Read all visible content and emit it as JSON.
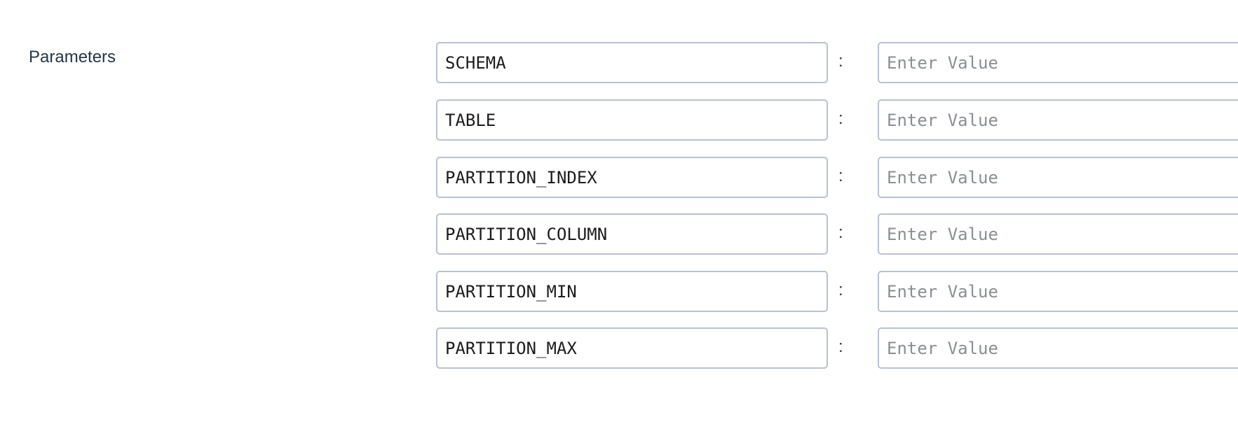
{
  "section": {
    "label": "Parameters"
  },
  "parameters": [
    {
      "key": "SCHEMA",
      "value": "",
      "placeholder": "Enter Value"
    },
    {
      "key": "TABLE",
      "value": "",
      "placeholder": "Enter Value"
    },
    {
      "key": "PARTITION_INDEX",
      "value": "",
      "placeholder": "Enter Value"
    },
    {
      "key": "PARTITION_COLUMN",
      "value": "",
      "placeholder": "Enter Value"
    },
    {
      "key": "PARTITION_MIN",
      "value": "",
      "placeholder": "Enter Value"
    },
    {
      "key": "PARTITION_MAX",
      "value": "",
      "placeholder": "Enter Value"
    }
  ],
  "separator": ":",
  "colors": {
    "label_text": "#253746",
    "link": "#1f79b3",
    "input_border": "#b6c2d0",
    "placeholder": "#8a8f95"
  }
}
